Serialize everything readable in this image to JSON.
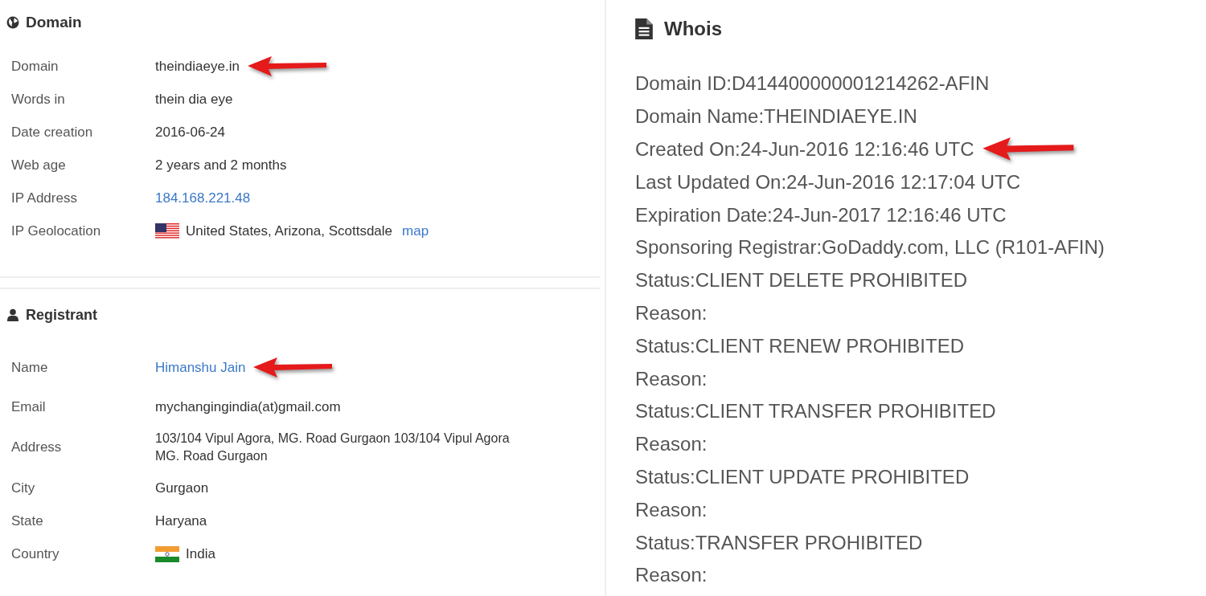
{
  "domain_section": {
    "title": "Domain",
    "rows": [
      {
        "label": "Domain",
        "value": "theindiaeye.in",
        "kind": "text",
        "annotated": true
      },
      {
        "label": "Words in",
        "value": "thein dia eye",
        "kind": "text",
        "annotated": false
      },
      {
        "label": "Date creation",
        "value": "2016-06-24",
        "kind": "text",
        "annotated": false
      },
      {
        "label": "Web age",
        "value": "2 years and 2 months",
        "kind": "text",
        "annotated": false
      },
      {
        "label": "IP Address",
        "value": "184.168.221.48",
        "kind": "link",
        "annotated": false
      },
      {
        "label": "IP Geolocation",
        "value": "United States, Arizona, Scottsdale",
        "link": "map",
        "kind": "geo",
        "annotated": false
      }
    ]
  },
  "registrant_section": {
    "title": "Registrant",
    "rows": [
      {
        "label": "Name",
        "value": "Himanshu Jain",
        "kind": "link",
        "annotated": true
      },
      {
        "label": "Email",
        "value": "mychangingindia(at)gmail.com",
        "kind": "text",
        "annotated": false
      },
      {
        "label": "Address",
        "lines": [
          "103/104 Vipul Agora, MG. Road Gurgaon 103/104 Vipul Agora",
          "MG. Road Gurgaon"
        ],
        "kind": "multiline",
        "annotated": false
      },
      {
        "label": "City",
        "value": "Gurgaon",
        "kind": "text",
        "annotated": false
      },
      {
        "label": "State",
        "value": "Haryana",
        "kind": "text",
        "annotated": false
      },
      {
        "label": "Country",
        "value": "India",
        "kind": "country",
        "annotated": false
      }
    ]
  },
  "whois": {
    "title": "Whois",
    "lines": [
      {
        "text": "Domain ID:D414400000001214262-AFIN",
        "annotated": false
      },
      {
        "text": "Domain Name:THEINDIAEYE.IN",
        "annotated": false
      },
      {
        "text": "Created On:24-Jun-2016 12:16:46 UTC",
        "annotated": true
      },
      {
        "text": "Last Updated On:24-Jun-2016 12:17:04 UTC",
        "annotated": false
      },
      {
        "text": "Expiration Date:24-Jun-2017 12:16:46 UTC",
        "annotated": false
      },
      {
        "text": "Sponsoring Registrar:GoDaddy.com, LLC (R101-AFIN)",
        "annotated": false
      },
      {
        "text": "Status:CLIENT DELETE PROHIBITED",
        "annotated": false
      },
      {
        "text": "Reason:",
        "annotated": false
      },
      {
        "text": "Status:CLIENT RENEW PROHIBITED",
        "annotated": false
      },
      {
        "text": "Reason:",
        "annotated": false
      },
      {
        "text": "Status:CLIENT TRANSFER PROHIBITED",
        "annotated": false
      },
      {
        "text": "Reason:",
        "annotated": false
      },
      {
        "text": "Status:CLIENT UPDATE PROHIBITED",
        "annotated": false
      },
      {
        "text": "Reason:",
        "annotated": false
      },
      {
        "text": "Status:TRANSFER PROHIBITED",
        "annotated": false
      },
      {
        "text": "Reason:",
        "annotated": false
      }
    ]
  }
}
